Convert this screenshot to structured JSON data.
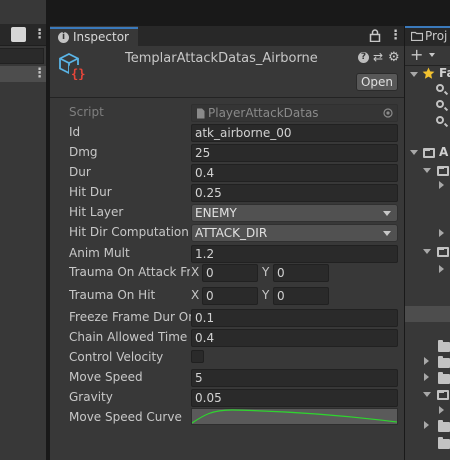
{
  "inspector": {
    "tab_label": "Inspector",
    "asset_title": "TemplarAttackDatas_Airborne",
    "open_label": "Open",
    "script": {
      "label": "Script",
      "value": "PlayerAttackDatas"
    },
    "fields": {
      "id": {
        "label": "Id",
        "value": "atk_airborne_00"
      },
      "dmg": {
        "label": "Dmg",
        "value": "25"
      },
      "dur": {
        "label": "Dur",
        "value": "0.4"
      },
      "hit_dur": {
        "label": "Hit Dur",
        "value": "0.25"
      },
      "hit_layer": {
        "label": "Hit Layer",
        "value": "ENEMY"
      },
      "hit_dir": {
        "label": "Hit Dir Computation T",
        "value": "ATTACK_DIR"
      },
      "anim_mult": {
        "label": "Anim Mult",
        "value": "1.2"
      },
      "trauma_attack": {
        "label": "Trauma On Attack Fra",
        "x_label": "X",
        "x": "0",
        "y_label": "Y",
        "y": "0"
      },
      "trauma_hit": {
        "label": "Trauma On Hit",
        "x_label": "X",
        "x": "0",
        "y_label": "Y",
        "y": "0"
      },
      "freeze": {
        "label": "Freeze Frame Dur On",
        "value": "0.1"
      },
      "chain": {
        "label": "Chain Allowed Time",
        "value": "0.4"
      },
      "control_velocity": {
        "label": "Control Velocity",
        "checked": false
      },
      "move_speed": {
        "label": "Move Speed",
        "value": "5"
      },
      "gravity": {
        "label": "Gravity",
        "value": "0.05"
      },
      "move_speed_curve": {
        "label": "Move Speed Curve",
        "curve_color": "#2fd42f"
      }
    }
  },
  "project": {
    "tab_label": "Proj",
    "favorites_label": "Fa",
    "assets_label": "A"
  },
  "colors": {
    "panel_bg": "#383838",
    "field_bg": "#2a2a2a",
    "tab_accent": "#3a79bb",
    "asset_icon_blue": "#5ab4e6",
    "asset_icon_red": "#e8463a",
    "favorite_star": "#f2c230"
  },
  "icons": [
    "lock-icon",
    "kebab-menu-icon",
    "info-icon",
    "scriptable-object-icon",
    "help-icon",
    "preset-icon",
    "settings-icon",
    "script-file-icon",
    "object-picker-icon",
    "dropdown-arrow-icon",
    "star-icon",
    "folder-icon",
    "search-icon",
    "add-icon"
  ]
}
